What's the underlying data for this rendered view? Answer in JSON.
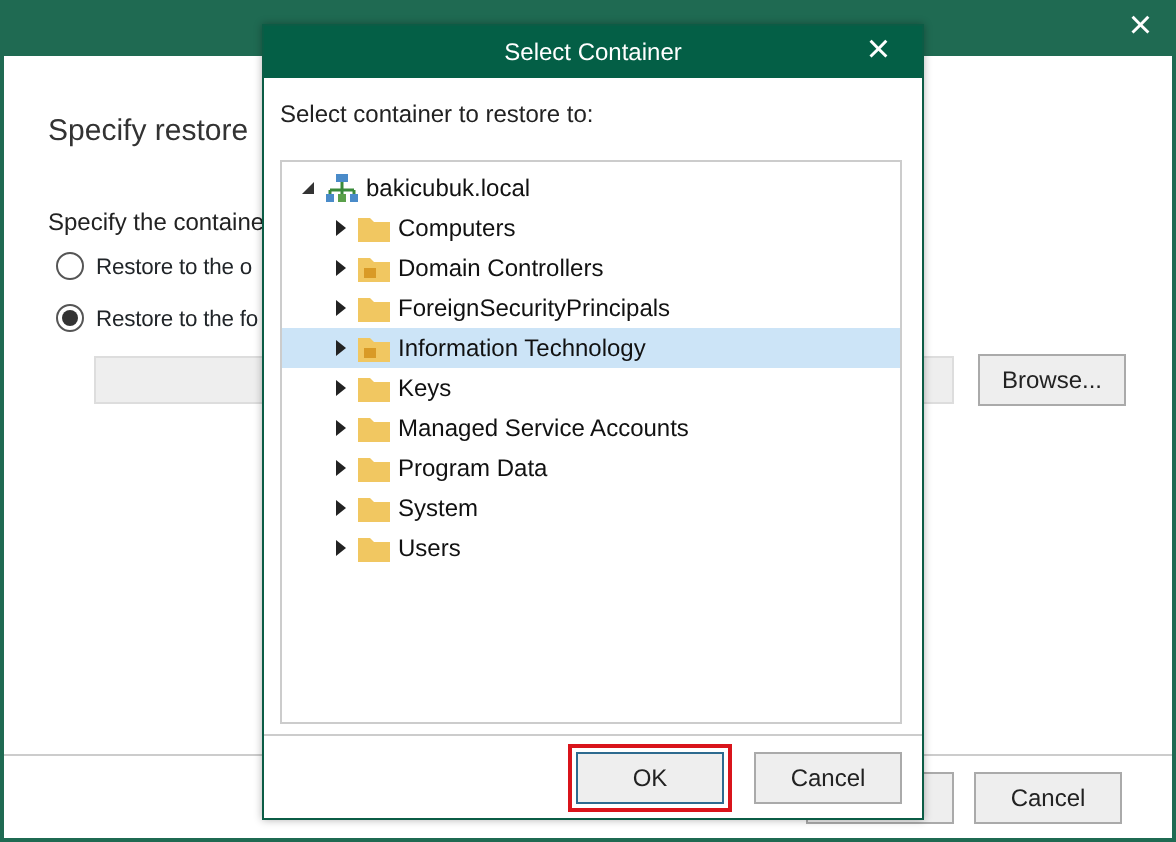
{
  "wizard": {
    "heading": "Specify restore",
    "prompt": "Specify the containe",
    "options": [
      {
        "label": "Restore to the o",
        "selected": false
      },
      {
        "label": "Restore to the fo",
        "selected": true
      }
    ],
    "browse_button": "Browse...",
    "cancel_button": "Cancel"
  },
  "dialog": {
    "title": "Select Container",
    "close": "×",
    "prompt": "Select container to restore to:",
    "tree": [
      {
        "label": "bakicubuk.local",
        "kind": "domain",
        "expanded": true,
        "selected": false,
        "children": [
          {
            "label": "Computers",
            "kind": "folder",
            "expanded": false,
            "selected": false
          },
          {
            "label": "Domain Controllers",
            "kind": "ou",
            "expanded": false,
            "selected": false
          },
          {
            "label": "ForeignSecurityPrincipals",
            "kind": "folder",
            "expanded": false,
            "selected": false
          },
          {
            "label": "Information Technology",
            "kind": "ou",
            "expanded": false,
            "selected": true
          },
          {
            "label": "Keys",
            "kind": "folder",
            "expanded": false,
            "selected": false
          },
          {
            "label": "Managed Service Accounts",
            "kind": "folder",
            "expanded": false,
            "selected": false
          },
          {
            "label": "Program Data",
            "kind": "folder",
            "expanded": false,
            "selected": false
          },
          {
            "label": "System",
            "kind": "folder",
            "expanded": false,
            "selected": false
          },
          {
            "label": "Users",
            "kind": "folder",
            "expanded": false,
            "selected": false
          }
        ]
      }
    ],
    "ok_button": "OK",
    "cancel_button": "Cancel"
  },
  "close": "×"
}
